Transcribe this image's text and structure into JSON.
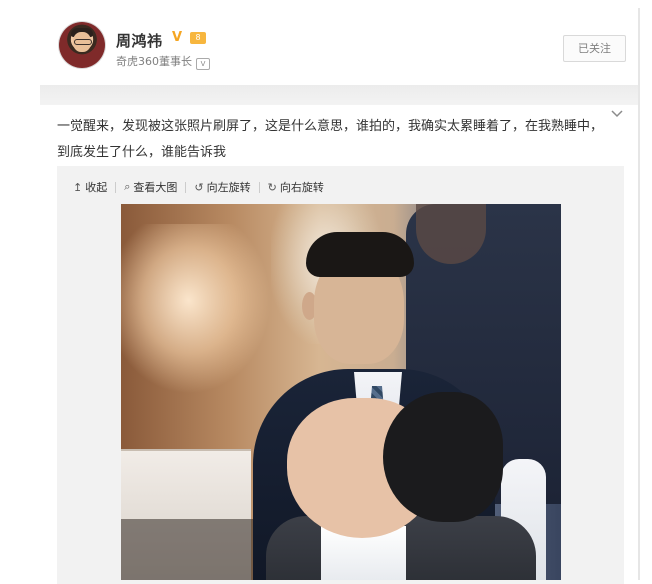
{
  "user": {
    "name": "周鸿祎",
    "verified_mark": "V",
    "level_badge": "8",
    "title": "奇虎360董事长",
    "vip_mark": "V"
  },
  "actions": {
    "follow_label": "已关注"
  },
  "post": {
    "text": "一觉醒来，发现被这张照片刷屏了，这是什么意思，谁拍的，我确实太累睡着了，在我熟睡中，到底发生了什么，谁能告诉我"
  },
  "media_toolbar": {
    "collapse": {
      "icon": "↥",
      "label": "收起"
    },
    "view_large": {
      "icon": "⌕",
      "label": "查看大图"
    },
    "rotate_left": {
      "icon": "↺",
      "label": "向左旋转"
    },
    "rotate_right": {
      "icon": "↻",
      "label": "向右旋转"
    }
  },
  "icons": {
    "expand_menu": "chevron-down-icon",
    "verified": "verified-v-icon",
    "level": "level-badge-icon",
    "vip": "vip-icon",
    "collapse": "collapse-up-icon",
    "search": "search-icon",
    "rotate_left": "rotate-left-icon",
    "rotate_right": "rotate-right-icon"
  },
  "colors": {
    "verified": "#f5a623",
    "text": "#333333",
    "muted": "#808080",
    "toolbar_bg": "#f2f2f2"
  }
}
